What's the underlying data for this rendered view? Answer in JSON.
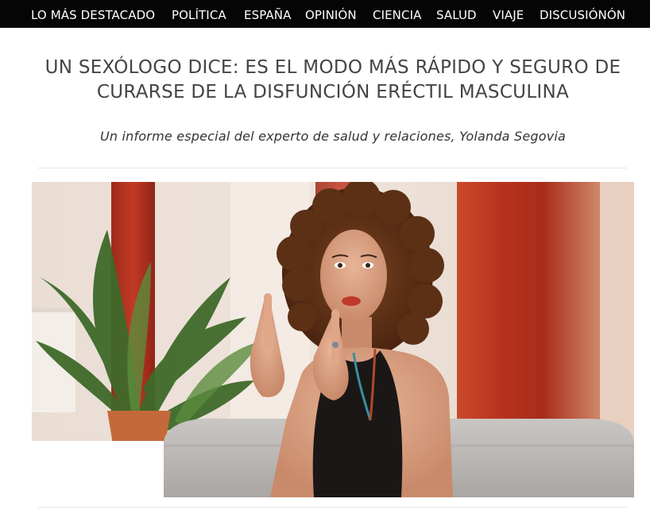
{
  "nav": {
    "items": [
      {
        "label": "LO MÁS DESTACADO"
      },
      {
        "label": "POLÍTICA"
      },
      {
        "label": "ESPAÑA"
      },
      {
        "label": "OPINIÓN"
      },
      {
        "label": "CIENCIA"
      },
      {
        "label": "SALUD"
      },
      {
        "label": "VIAJE"
      },
      {
        "label": "DISCUSIÓNÓN"
      }
    ]
  },
  "article": {
    "headline_line1": "UN SEXÓLOGO DICE: ES EL MODO MÁS RÁPIDO Y SEGURO DE",
    "headline_line2": "CURARSE DE LA DISFUNCIÓN ERÉCTIL MASCULINA",
    "byline": "Un informe especial del experto de salud y relaciones, Yolanda Segovia"
  },
  "colors": {
    "nav_background": "#050505",
    "nav_text": "#ffffff",
    "headline_text": "#444444",
    "curtain_red": "#b8331f"
  }
}
